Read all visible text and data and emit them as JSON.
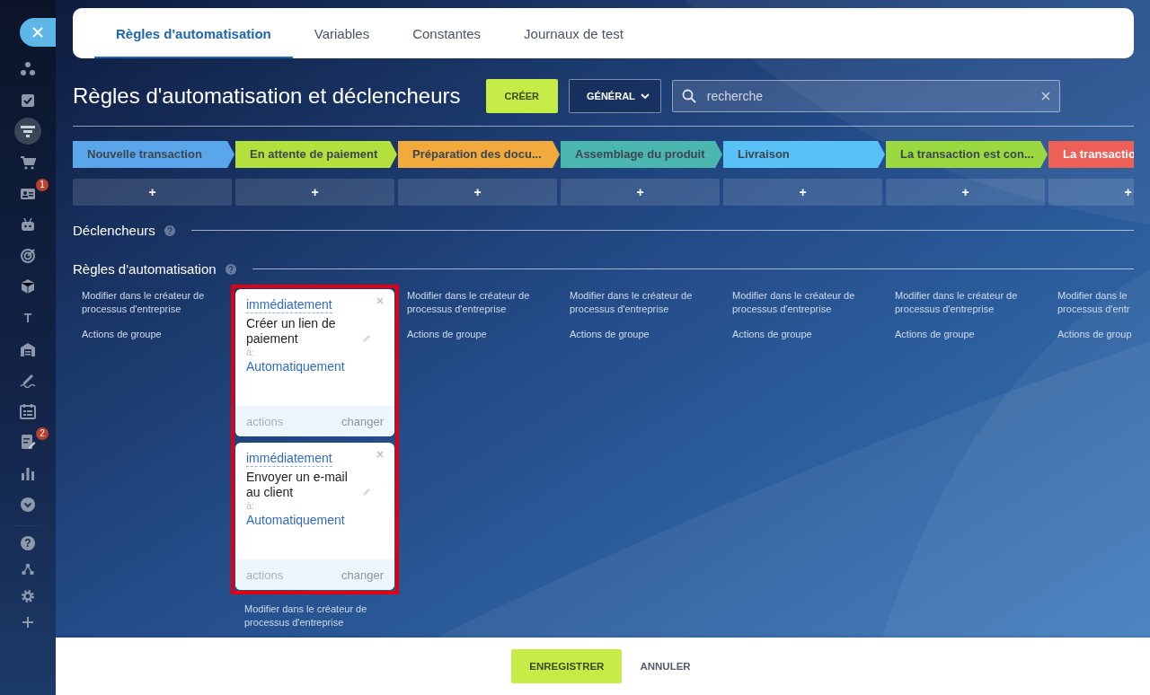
{
  "sidebar": {
    "items": [
      {
        "selected": false
      },
      {
        "selected": false
      },
      {
        "selected": true
      },
      {
        "selected": false
      },
      {
        "selected": false,
        "badge": "1"
      },
      {
        "selected": false
      },
      {
        "selected": false
      },
      {
        "selected": false
      },
      {
        "selected": false,
        "glyph": "T"
      },
      {
        "selected": false
      },
      {
        "selected": false
      },
      {
        "selected": false
      },
      {
        "selected": false,
        "badge": "2"
      },
      {
        "selected": false
      },
      {
        "selected": false
      }
    ],
    "bottom_items": [
      {
        "kind": "glyph",
        "glyph": "?"
      },
      {
        "kind": "icon"
      },
      {
        "kind": "icon"
      },
      {
        "kind": "icon"
      }
    ]
  },
  "tabs": [
    {
      "label": "Règles d'automatisation",
      "selected": true
    },
    {
      "label": "Variables",
      "selected": false
    },
    {
      "label": "Constantes",
      "selected": false
    },
    {
      "label": "Journaux de test",
      "selected": false
    }
  ],
  "header": {
    "title": "Règles d'automatisation et déclencheurs",
    "create_button": "CRÉER",
    "filter_button": "GÉNÉRAL",
    "search": {
      "placeholder": "recherche"
    }
  },
  "stages": [
    {
      "name": "Nouvelle transaction",
      "color": "#5aa6eb",
      "add": "+"
    },
    {
      "name": "En attente de paiement",
      "color": "#b4e03e",
      "add": "+"
    },
    {
      "name": "Préparation des docu...",
      "color": "#f2aa3c",
      "add": "+"
    },
    {
      "name": "Assemblage du produit",
      "color": "#4cb7ae",
      "add": "+"
    },
    {
      "name": "Livraison",
      "color": "#58c2f6",
      "add": "+"
    },
    {
      "name": "La transaction est con...",
      "color": "#9ad93f",
      "add": "+"
    },
    {
      "name": "La transactio",
      "color": "#ee5f56",
      "add": "+"
    }
  ],
  "triggers_section": {
    "title": "Déclencheurs"
  },
  "rules_section": {
    "title": "Règles d'automatisation"
  },
  "columns": [
    {
      "highlighted": false,
      "links": [
        "Modifier dans le créateur de processus d'entreprise",
        "Actions de groupe"
      ]
    },
    {
      "highlighted": true,
      "robots": [
        {
          "delay": "immédiatement",
          "title": "Créer un lien de paiement",
          "to_label": "à:",
          "responsible": "Automatiquement",
          "actions": {
            "label": "actions",
            "disabled": true
          },
          "change": "changer"
        },
        {
          "delay": "immédiatement",
          "title": "Envoyer un e-mail au client",
          "to_label": "à:",
          "responsible": "Automatiquement",
          "actions": {
            "label": "actions",
            "disabled": true
          },
          "change": "changer"
        }
      ],
      "links": [
        "Modifier dans le créateur de processus d'entreprise"
      ]
    },
    {
      "highlighted": false,
      "links": [
        "Modifier dans le créateur de processus d'entreprise",
        "Actions de groupe"
      ]
    },
    {
      "highlighted": false,
      "links": [
        "Modifier dans le créateur de processus d'entreprise",
        "Actions de groupe"
      ]
    },
    {
      "highlighted": false,
      "links": [
        "Modifier dans le créateur de processus d'entreprise",
        "Actions de groupe"
      ]
    },
    {
      "highlighted": false,
      "links": [
        "Modifier dans le créateur de processus d'entreprise",
        "Actions de groupe"
      ]
    },
    {
      "highlighted": false,
      "links": [
        "Modifier dans le\nprocessus d'entr",
        "Actions de group"
      ]
    }
  ],
  "footer": {
    "save_button": "ENREGISTRER",
    "cancel_button": "ANNULER"
  }
}
